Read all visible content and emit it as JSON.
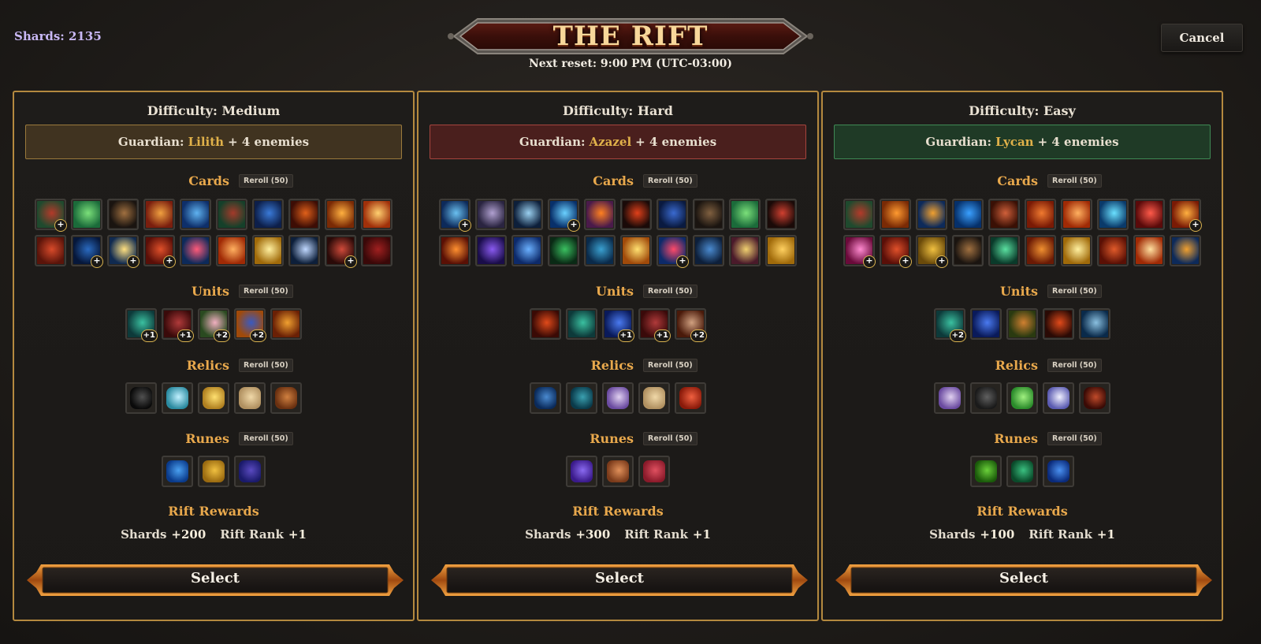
{
  "header": {
    "shards_label": "Shards: 2135",
    "title": "THE RIFT",
    "reset": "Next reset: 9:00 PM (UTC-03:00)",
    "cancel_label": "Cancel"
  },
  "labels": {
    "cards": "Cards",
    "units": "Units",
    "relics": "Relics",
    "runes": "Runes",
    "reroll": "Reroll (50)",
    "rift_rewards": "Rift Rewards",
    "shards": "Shards",
    "rift_rank": "Rift Rank",
    "guardian": "Guardian:",
    "enemies": "+ 4 enemies",
    "select": "Select"
  },
  "panels": [
    {
      "difficulty": "Difficulty: Medium",
      "guardian_name": "Lilith",
      "theme": "medium",
      "cards_row1": [
        {
          "c1": "#1f4a2e",
          "c2": "#b33a2a",
          "badge": "+"
        },
        {
          "c1": "#1b6b3a",
          "c2": "#7be07a",
          "badge": ""
        },
        {
          "c1": "#1a1410",
          "c2": "#a07040",
          "badge": ""
        },
        {
          "c1": "#7a1e0e",
          "c2": "#f0a040",
          "badge": ""
        },
        {
          "c1": "#0e2f6a",
          "c2": "#5fb2f0",
          "badge": ""
        },
        {
          "c1": "#15402a",
          "c2": "#a33a2a",
          "badge": ""
        },
        {
          "c1": "#0d1f4a",
          "c2": "#3a7ad8",
          "badge": ""
        },
        {
          "c1": "#3d0d05",
          "c2": "#e0601a",
          "badge": ""
        },
        {
          "c1": "#7a2a05",
          "c2": "#ffb040",
          "badge": ""
        },
        {
          "c1": "#a0300a",
          "c2": "#ffd070",
          "badge": ""
        }
      ],
      "cards_row2": [
        {
          "c1": "#5a140a",
          "c2": "#d84a2a",
          "badge": ""
        },
        {
          "c1": "#06173a",
          "c2": "#2a6ac0",
          "badge": "+"
        },
        {
          "c1": "#102a50",
          "c2": "#ffe080",
          "badge": "+"
        },
        {
          "c1": "#5a0f08",
          "c2": "#e0502a",
          "badge": "+"
        },
        {
          "c1": "#0d2a5a",
          "c2": "#ff5a7a",
          "badge": ""
        },
        {
          "c1": "#a02a05",
          "c2": "#ffb060",
          "badge": ""
        },
        {
          "c1": "#a06a0a",
          "c2": "#fff0a0",
          "badge": ""
        },
        {
          "c1": "#0d1f3a",
          "c2": "#c0d8ff",
          "badge": ""
        },
        {
          "c1": "#2a0a08",
          "c2": "#d04a3a",
          "badge": "+"
        },
        {
          "c1": "#3a0808",
          "c2": "#a02020",
          "badge": ""
        }
      ],
      "units": [
        {
          "c1": "#0d3a3a",
          "c2": "#3ac0a0",
          "badge": "+1"
        },
        {
          "c1": "#3a0a0a",
          "c2": "#b03a3a",
          "badge": "+1"
        },
        {
          "c1": "#2a4a20",
          "c2": "#f0b0c0",
          "badge": "+2"
        },
        {
          "c1": "#a04a0a",
          "c2": "#3a5ac0",
          "badge": "+2"
        },
        {
          "c1": "#6a2005",
          "c2": "#f0a030",
          "badge": ""
        }
      ],
      "relics": [
        {
          "c1": "#0a0a0a",
          "c2": "#505050"
        },
        {
          "c1": "#2a8aa0",
          "c2": "#c0f0ff"
        },
        {
          "c1": "#b08020",
          "c2": "#ffe070"
        },
        {
          "c1": "#b09060",
          "c2": "#f0d8a8"
        },
        {
          "c1": "#6a3010",
          "c2": "#d08040"
        }
      ],
      "runes": [
        {
          "c1": "#0a3a8a",
          "c2": "#4aa0f0"
        },
        {
          "c1": "#9a6a10",
          "c2": "#f0c040"
        },
        {
          "c1": "#1a1a6a",
          "c2": "#5a4ac0"
        }
      ],
      "shards_reward": "+200",
      "rank_reward": "+1"
    },
    {
      "difficulty": "Difficulty: Hard",
      "guardian_name": "Azazel",
      "theme": "hard",
      "cards_row1": [
        {
          "c1": "#0d2a5a",
          "c2": "#6ac0f0",
          "badge": "+"
        },
        {
          "c1": "#2a2440",
          "c2": "#b0a0d0",
          "badge": ""
        },
        {
          "c1": "#0d1f3a",
          "c2": "#9ad0f0",
          "badge": ""
        },
        {
          "c1": "#08306a",
          "c2": "#6ad0ff",
          "badge": "+"
        },
        {
          "c1": "#4a1a4a",
          "c2": "#ff8020",
          "badge": ""
        },
        {
          "c1": "#1a0a08",
          "c2": "#e0401a",
          "badge": ""
        },
        {
          "c1": "#0a1a40",
          "c2": "#3a6ad0",
          "badge": ""
        },
        {
          "c1": "#1a1410",
          "c2": "#806040",
          "badge": ""
        },
        {
          "c1": "#1b6b3a",
          "c2": "#7be07a",
          "badge": ""
        },
        {
          "c1": "#1a0a08",
          "c2": "#d04030",
          "badge": ""
        }
      ],
      "cards_row2": [
        {
          "c1": "#5a1005",
          "c2": "#ff9030",
          "badge": ""
        },
        {
          "c1": "#1a0d4a",
          "c2": "#8a5af0",
          "badge": ""
        },
        {
          "c1": "#0d2a6a",
          "c2": "#6ab0ff",
          "badge": ""
        },
        {
          "c1": "#0a2a15",
          "c2": "#3ac060",
          "badge": ""
        },
        {
          "c1": "#0a2a4a",
          "c2": "#3aa0d0",
          "badge": ""
        },
        {
          "c1": "#a04a0a",
          "c2": "#ffe070",
          "badge": ""
        },
        {
          "c1": "#0d2a6a",
          "c2": "#ff4a6a",
          "badge": "+"
        },
        {
          "c1": "#0d1f3a",
          "c2": "#4a8ad0",
          "badge": ""
        },
        {
          "c1": "#4a1a2a",
          "c2": "#f0d070",
          "badge": ""
        },
        {
          "c1": "#a06a0a",
          "c2": "#ffd060",
          "badge": ""
        }
      ],
      "units": [
        {
          "c1": "#3a0a05",
          "c2": "#e04a1a",
          "badge": ""
        },
        {
          "c1": "#0d3a3a",
          "c2": "#3ac0a0",
          "badge": ""
        },
        {
          "c1": "#0a1a5a",
          "c2": "#4a7af0",
          "badge": "+1"
        },
        {
          "c1": "#3a0a0a",
          "c2": "#b03a3a",
          "badge": "+1"
        },
        {
          "c1": "#4a1a0a",
          "c2": "#d0a080",
          "badge": "+2"
        }
      ],
      "relics": [
        {
          "c1": "#0a2a5a",
          "c2": "#4a8ad0"
        },
        {
          "c1": "#0a3a4a",
          "c2": "#3aa0b0"
        },
        {
          "c1": "#6a4aa0",
          "c2": "#e0d0f0"
        },
        {
          "c1": "#b09060",
          "c2": "#f0d8a8"
        },
        {
          "c1": "#8a1a0a",
          "c2": "#f06040"
        }
      ],
      "runes": [
        {
          "c1": "#3a1a8a",
          "c2": "#8a6af0"
        },
        {
          "c1": "#7a3a1a",
          "c2": "#e0905a"
        },
        {
          "c1": "#8a1a2a",
          "c2": "#e05060"
        }
      ],
      "shards_reward": "+300",
      "rank_reward": "+1"
    },
    {
      "difficulty": "Difficulty: Easy",
      "guardian_name": "Lycan",
      "theme": "easy",
      "cards_row1": [
        {
          "c1": "#1f4a2e",
          "c2": "#b33a2a",
          "badge": ""
        },
        {
          "c1": "#7a2a05",
          "c2": "#ff9a30",
          "badge": ""
        },
        {
          "c1": "#0d2a5a",
          "c2": "#f0a030",
          "badge": ""
        },
        {
          "c1": "#06306a",
          "c2": "#3aa0ff",
          "badge": ""
        },
        {
          "c1": "#3a1005",
          "c2": "#d0603a",
          "badge": ""
        },
        {
          "c1": "#7a1a05",
          "c2": "#f07a30",
          "badge": ""
        },
        {
          "c1": "#a02a05",
          "c2": "#ffb060",
          "badge": ""
        },
        {
          "c1": "#0a3a6a",
          "c2": "#6ae0ff",
          "badge": ""
        },
        {
          "c1": "#5a0a0a",
          "c2": "#ff5a4a",
          "badge": ""
        },
        {
          "c1": "#7a1a05",
          "c2": "#ffb040",
          "badge": "+"
        }
      ],
      "cards_row2": [
        {
          "c1": "#6a0a3a",
          "c2": "#ff8ad0",
          "badge": "+"
        },
        {
          "c1": "#5a0f08",
          "c2": "#e0502a",
          "badge": "+"
        },
        {
          "c1": "#6a4a0a",
          "c2": "#f0c040",
          "badge": "+"
        },
        {
          "c1": "#1a1410",
          "c2": "#a07040",
          "badge": ""
        },
        {
          "c1": "#0a3a2a",
          "c2": "#5ae0a0",
          "badge": ""
        },
        {
          "c1": "#6a1a05",
          "c2": "#f09030",
          "badge": ""
        },
        {
          "c1": "#a06a0a",
          "c2": "#fff0a0",
          "badge": ""
        },
        {
          "c1": "#5a1005",
          "c2": "#e05a2a",
          "badge": ""
        },
        {
          "c1": "#a02a05",
          "c2": "#ffe0a0",
          "badge": ""
        },
        {
          "c1": "#0d2a5a",
          "c2": "#f0a030",
          "badge": ""
        }
      ],
      "units": [
        {
          "c1": "#0d3a3a",
          "c2": "#3ac0a0",
          "badge": "+2"
        },
        {
          "c1": "#0a1a5a",
          "c2": "#4a7af0",
          "badge": ""
        },
        {
          "c1": "#2a3a10",
          "c2": "#d08030",
          "badge": ""
        },
        {
          "c1": "#2a0a05",
          "c2": "#e04a1a",
          "badge": ""
        },
        {
          "c1": "#0a2a4a",
          "c2": "#8ac0e0",
          "badge": ""
        }
      ],
      "relics": [
        {
          "c1": "#6a4aa0",
          "c2": "#e0d0f0"
        },
        {
          "c1": "#1a1a1a",
          "c2": "#606060"
        },
        {
          "c1": "#2a8a2a",
          "c2": "#a0f080"
        },
        {
          "c1": "#5a5ab0",
          "c2": "#f0f0ff"
        },
        {
          "c1": "#3a0a05",
          "c2": "#c04a2a"
        }
      ],
      "runes": [
        {
          "c1": "#1a5a0a",
          "c2": "#6ad03a"
        },
        {
          "c1": "#0a4a2a",
          "c2": "#3ac080"
        },
        {
          "c1": "#0a2a7a",
          "c2": "#4a90f0"
        }
      ],
      "shards_reward": "+100",
      "rank_reward": "+1"
    }
  ]
}
